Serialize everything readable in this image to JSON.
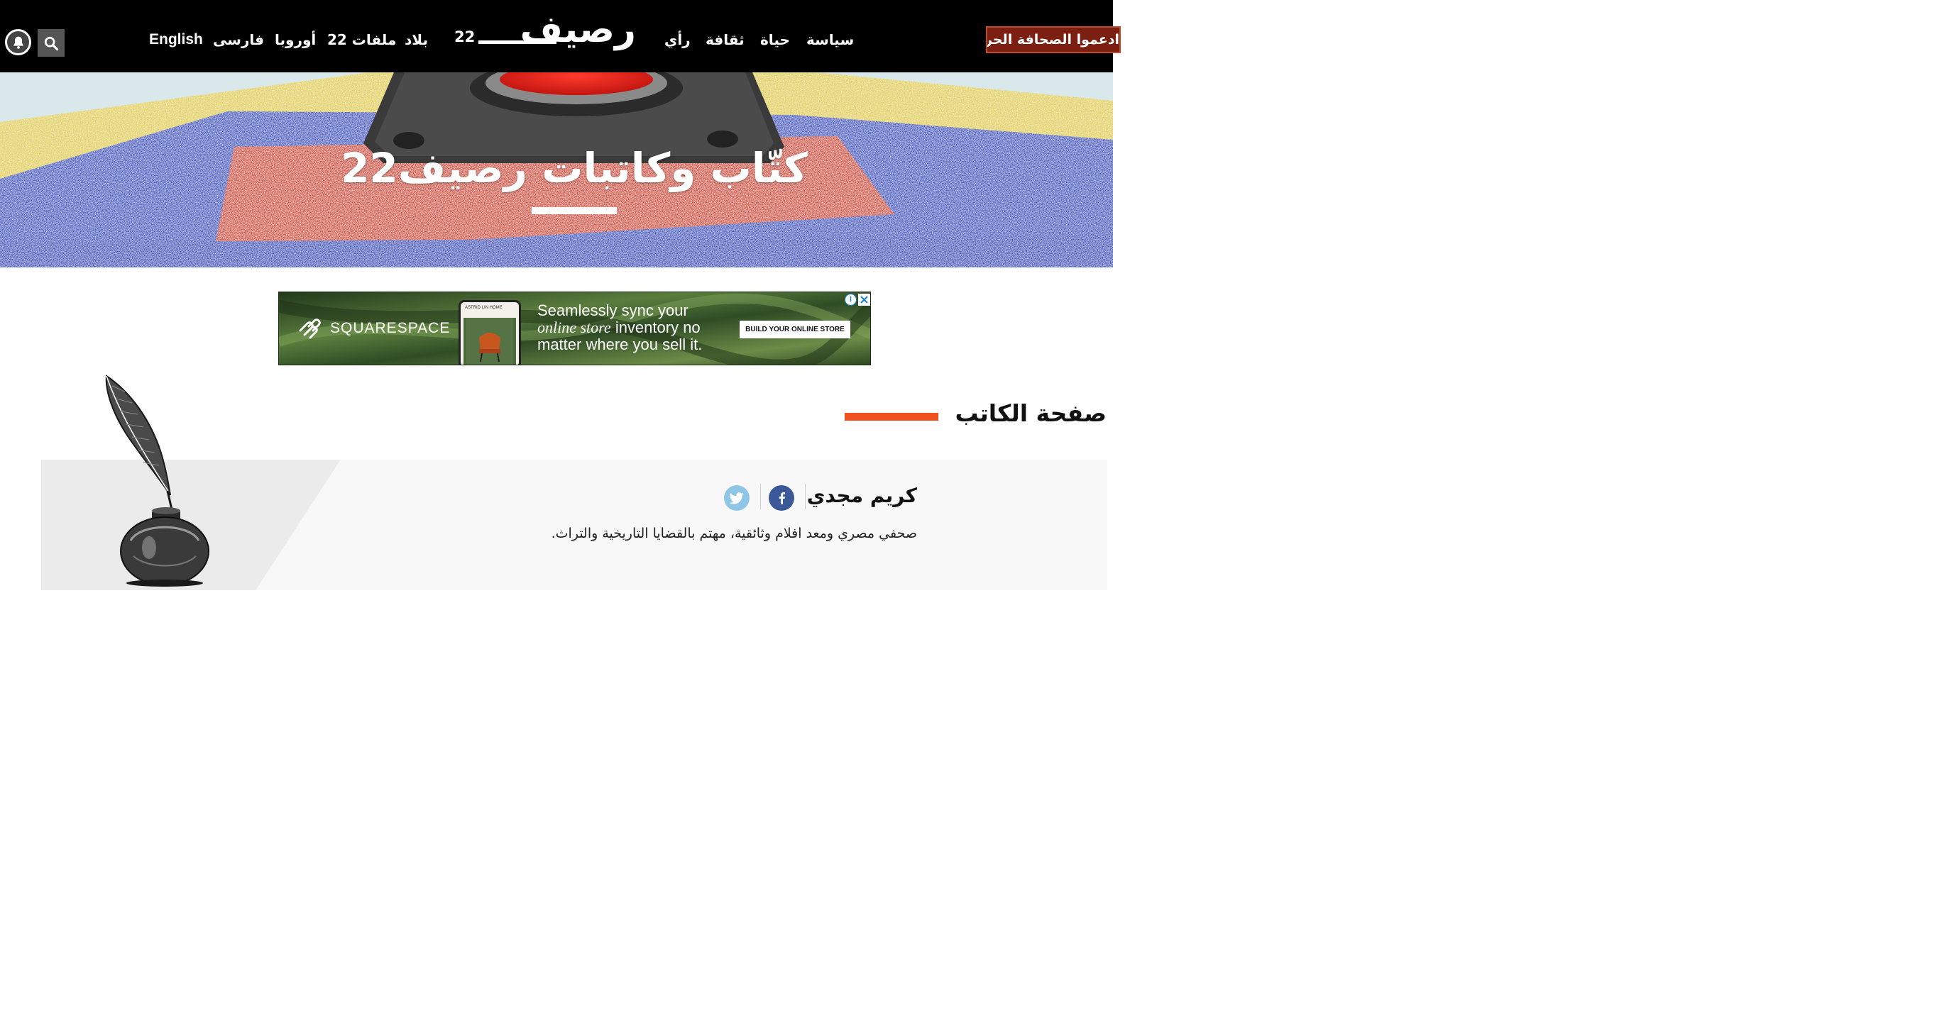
{
  "header": {
    "logo_word": "رصيف",
    "logo_number": "22",
    "nav": [
      {
        "id": "english",
        "label": "English"
      },
      {
        "id": "farsi",
        "label": "فارسی"
      },
      {
        "id": "europe",
        "label": "أوروبا"
      },
      {
        "id": "files22",
        "label": "ملفات 22"
      },
      {
        "id": "countries",
        "label": "بلاد"
      },
      {
        "id": "opinion",
        "label": "رأي"
      },
      {
        "id": "culture",
        "label": "ثقافة"
      },
      {
        "id": "life",
        "label": "حياة"
      },
      {
        "id": "politics",
        "label": "سياسة"
      }
    ],
    "subscribe_label": "ادعموا الصحافة الحرة"
  },
  "hero": {
    "title": "كتّاب وكاتبات رصيف22"
  },
  "ad": {
    "brand": "SQUARESPACE",
    "phone_header": "ASTRID LIN HOME",
    "headline_part1": "Seamlessly sync your",
    "headline_italic": "online store",
    "headline_part2": "inventory no matter where you sell it.",
    "cta": "BUILD YOUR ONLINE STORE",
    "info_glyph": "i"
  },
  "section": {
    "title": "صفحة الكاتب"
  },
  "author": {
    "name": "كريم مجدي",
    "bio": "صحفي مصري ومعد افلام وثائقية، مهتم بالقضايا التاريخية والتراث."
  },
  "icons": {
    "bell": "bell-icon",
    "search": "search-icon",
    "facebook": "facebook-icon",
    "twitter": "twitter-icon",
    "close": "close-icon",
    "info": "info-icon",
    "quill": "quill-inkwell-illustration"
  },
  "colors": {
    "header_bg": "#000000",
    "accent_orange": "#f0501e",
    "subscribe_bg": "#7a1f12",
    "facebook": "#3b5998",
    "twitter": "#8fc6e6",
    "card_bg": "#f8f8f8"
  }
}
